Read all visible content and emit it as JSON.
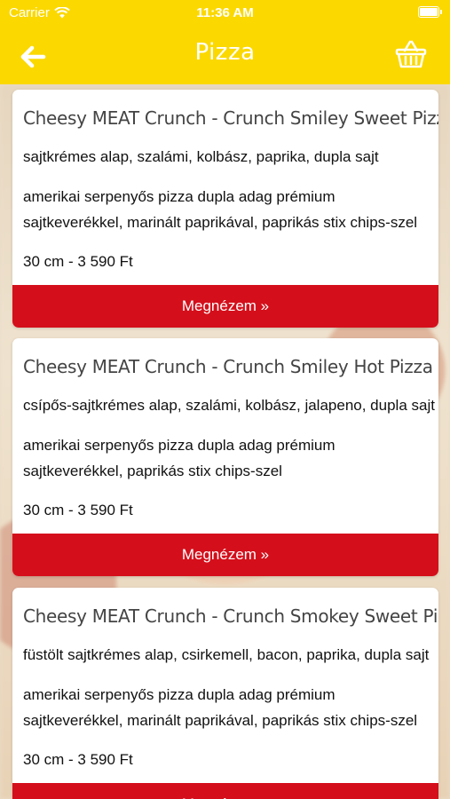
{
  "status_bar": {
    "carrier": "Carrier",
    "time": "11:36 AM",
    "wifi_icon": "wifi-icon",
    "battery_icon": "battery-icon"
  },
  "nav": {
    "title": "Pizza",
    "back_icon": "back-arrow-icon",
    "basket_icon": "basket-icon"
  },
  "colors": {
    "header": "#fbd800",
    "button": "#d40f1b"
  },
  "products": [
    {
      "title": "Cheesy MEAT Crunch - Crunch Smiley Sweet Pizza",
      "ingredients": "sajtkrémes alap, szalámi, kolbász, paprika, dupla sajt",
      "description": "amerikai serpenyős pizza dupla adag prémium sajtkeverékkel, marinált paprikával, paprikás stix chips-szel",
      "price": "30 cm - 3 590 Ft",
      "button_label": "Megnézem »"
    },
    {
      "title": "Cheesy MEAT Crunch - Crunch Smiley Hot Pizza",
      "ingredients": "csípős-sajtkrémes alap, szalámi, kolbász, jalapeno, dupla sajt",
      "description": "amerikai serpenyős pizza dupla adag prémium sajtkeverékkel, paprikás stix chips-szel",
      "price": "30 cm - 3 590 Ft",
      "button_label": "Megnézem »"
    },
    {
      "title": "Cheesy MEAT Crunch - Crunch Smokey Sweet Pizza",
      "ingredients": "füstölt sajtkrémes alap, csirkemell, bacon, paprika, dupla sajt",
      "description": "amerikai serpenyős pizza dupla adag prémium sajtkeverékkel, marinált paprikával, paprikás stix chips-szel",
      "price": "30 cm - 3 590 Ft",
      "button_label": "Megnézem »"
    }
  ]
}
